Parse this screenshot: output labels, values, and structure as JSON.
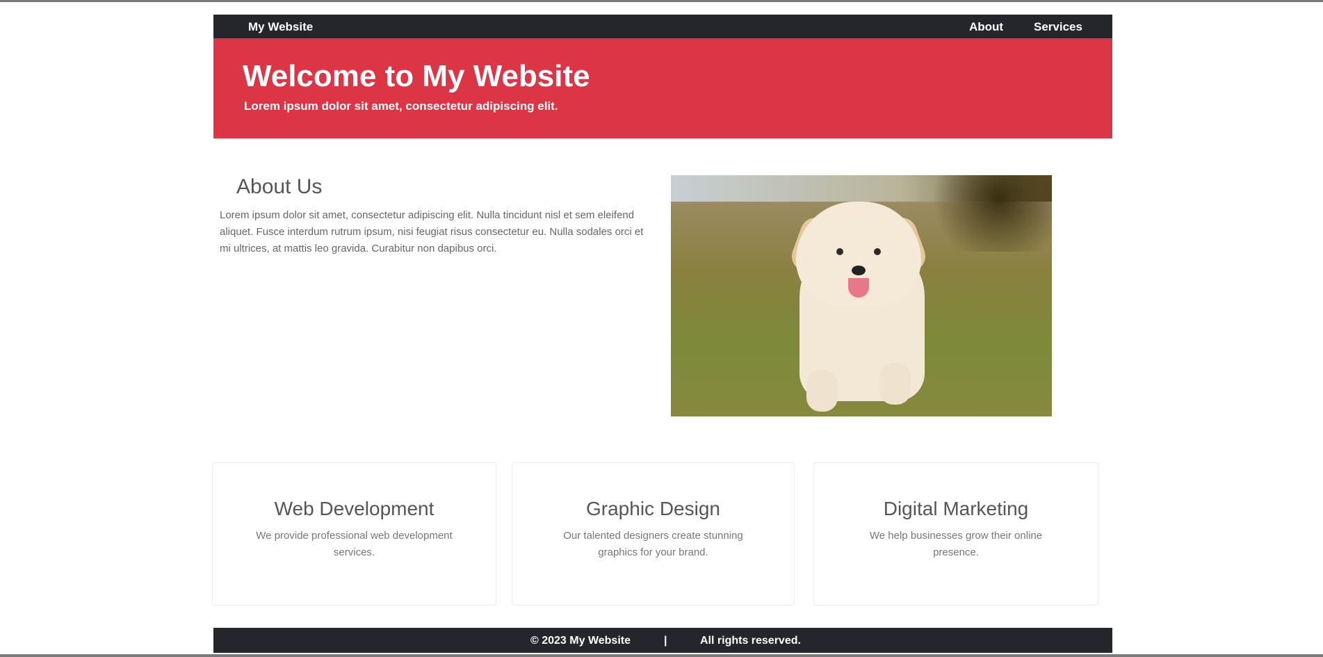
{
  "nav": {
    "brand": "My Website",
    "links": [
      "About",
      "Services"
    ]
  },
  "hero": {
    "title": "Welcome to My Website",
    "subtitle": "Lorem ipsum dolor sit amet, consectetur adipiscing elit."
  },
  "about": {
    "heading": "About Us",
    "text": "Lorem ipsum dolor sit amet, consectetur adipiscing elit. Nulla tincidunt nisl et sem eleifend aliquet. Fusce interdum rutrum ipsum, nisi feugiat risus consectetur eu. Nulla sodales orci et mi ultrices, at mattis leo gravida. Curabitur non dapibus orci."
  },
  "services": [
    {
      "title": "Web Development",
      "text": "We provide professional web development services."
    },
    {
      "title": "Graphic Design",
      "text": "Our talented designers create stunning graphics for your brand."
    },
    {
      "title": "Digital Marketing",
      "text": "We help businesses grow their online presence."
    }
  ],
  "footer": {
    "copyright": "© 2023 My Website",
    "separator": "|",
    "rights": "All rights reserved."
  },
  "colors": {
    "nav_bg": "#24262b",
    "hero_bg": "#dc3545"
  }
}
